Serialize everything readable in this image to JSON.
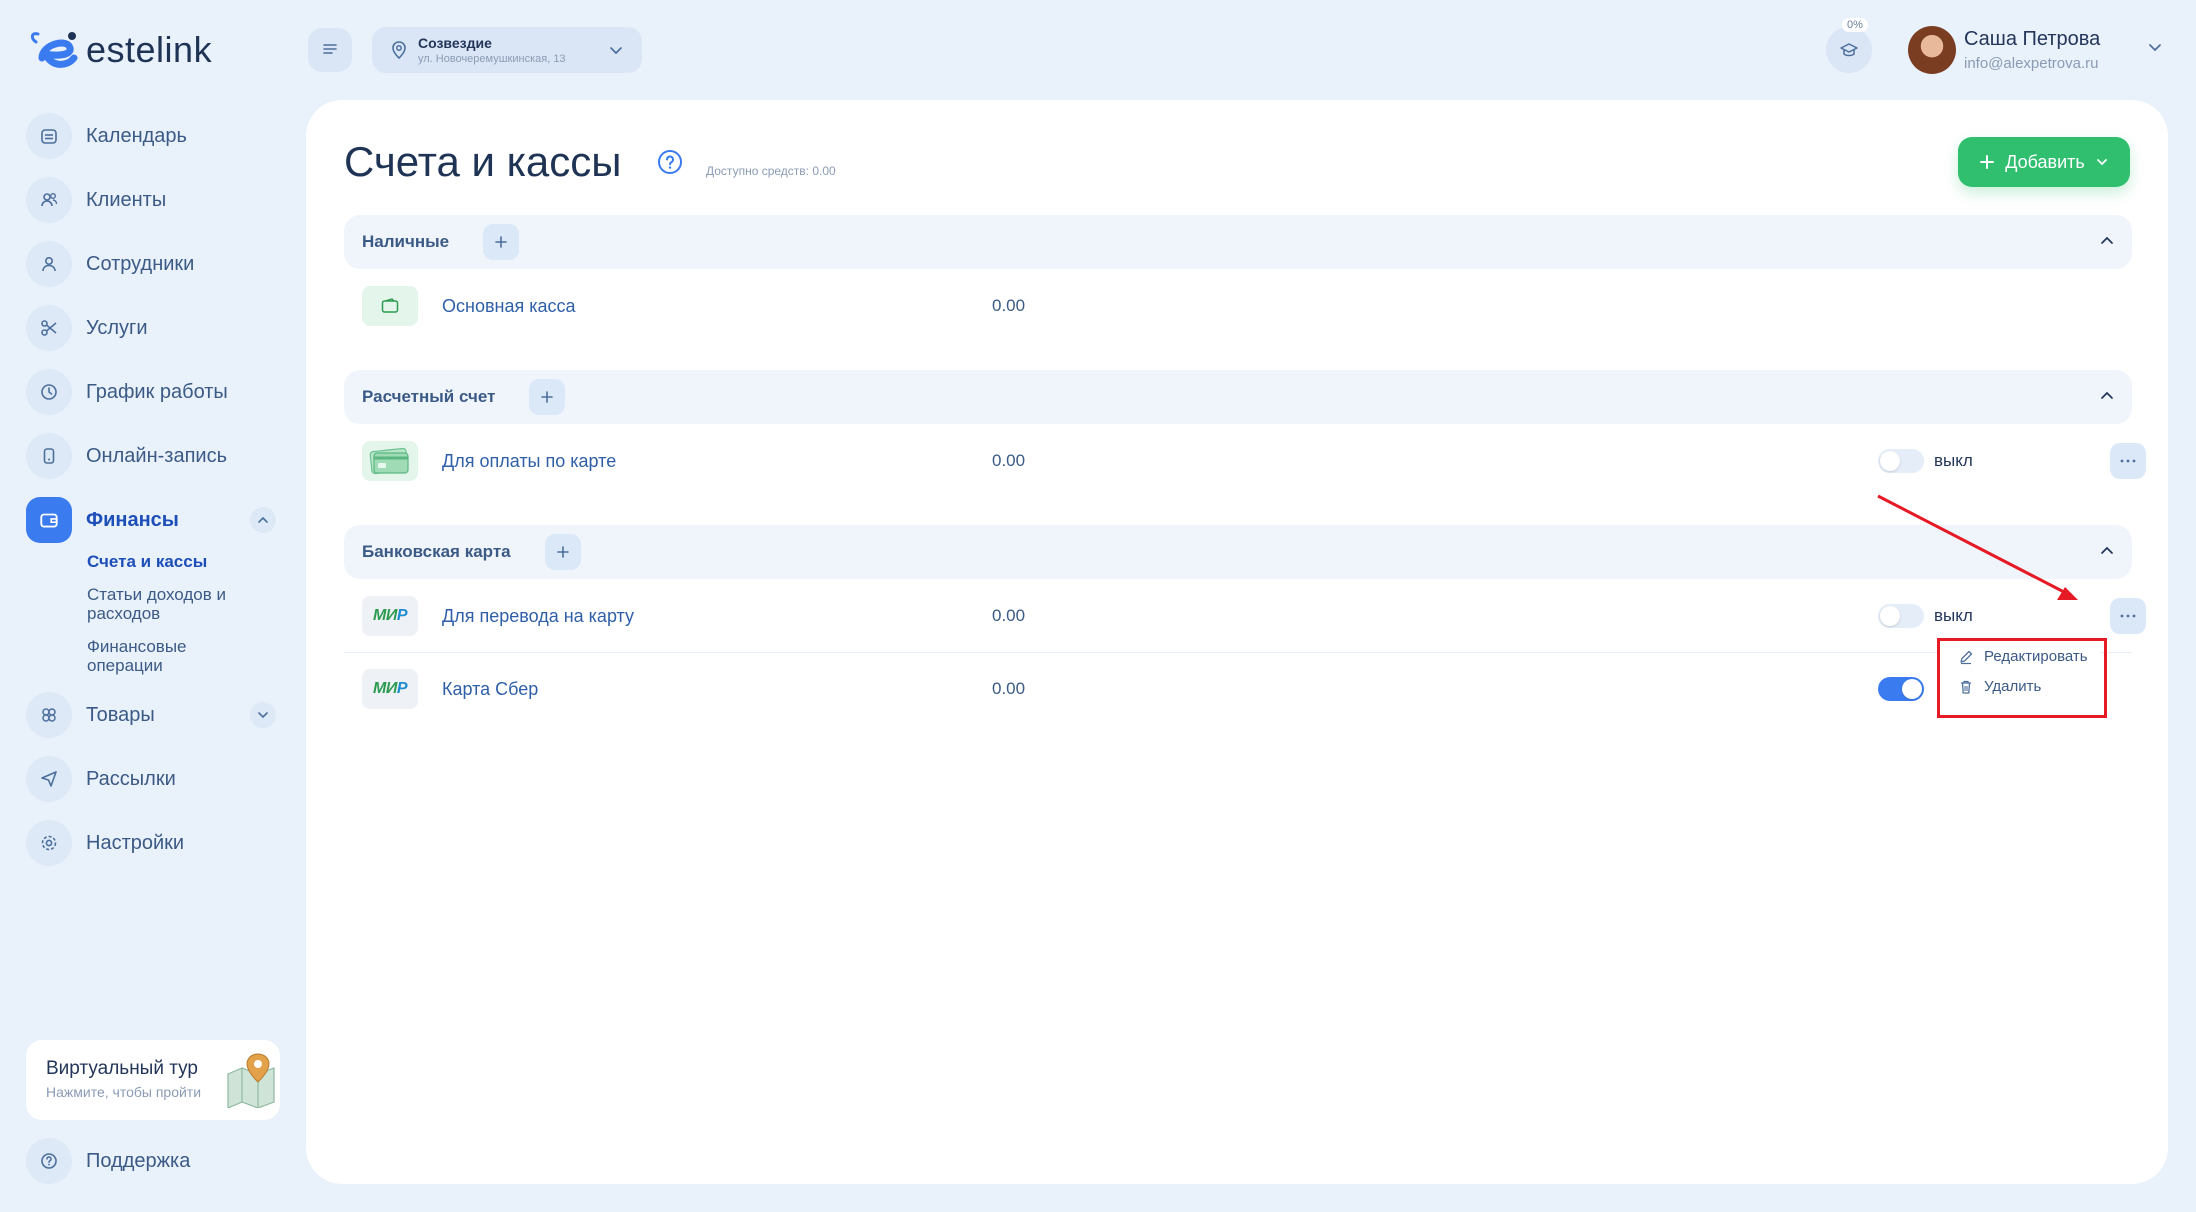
{
  "app": {
    "logo_text": "estelink"
  },
  "sidebar": {
    "items": [
      {
        "id": "calendar",
        "label": "Календарь",
        "icon": "calendar-icon"
      },
      {
        "id": "clients",
        "label": "Клиенты",
        "icon": "users-icon"
      },
      {
        "id": "staff",
        "label": "Сотрудники",
        "icon": "user-icon"
      },
      {
        "id": "services",
        "label": "Услуги",
        "icon": "scissors-icon"
      },
      {
        "id": "schedule",
        "label": "График работы",
        "icon": "clock-icon"
      },
      {
        "id": "booking",
        "label": "Онлайн-запись",
        "icon": "phone-icon"
      },
      {
        "id": "finance",
        "label": "Финансы",
        "icon": "wallet-icon",
        "active": true
      },
      {
        "id": "goods",
        "label": "Товары",
        "icon": "boxes-icon"
      },
      {
        "id": "mailing",
        "label": "Рассылки",
        "icon": "send-icon"
      },
      {
        "id": "settings",
        "label": "Настройки",
        "icon": "gear-icon"
      }
    ],
    "finance_sub": [
      {
        "label": "Счета и кассы",
        "active": true
      },
      {
        "label": "Статьи доходов и расходов"
      },
      {
        "label": "Финансовые операции"
      }
    ],
    "tour": {
      "title": "Виртуальный тур",
      "subtitle": "Нажмите, чтобы пройти"
    },
    "support": {
      "label": "Поддержка"
    }
  },
  "topbar": {
    "location": {
      "name": "Созвездие",
      "address": "ул. Новочеремушкинская, 13"
    },
    "progress_badge": "0%",
    "user": {
      "name": "Саша Петрова",
      "email": "info@alexpetrova.ru"
    }
  },
  "main": {
    "title": "Счета и кассы",
    "available": "Доступно средств: 0.00",
    "add_button": "Добавить",
    "sections": [
      {
        "title": "Наличные",
        "rows": [
          {
            "name": "Основная касса",
            "amount": "0.00",
            "icon": "wallet-icon"
          }
        ]
      },
      {
        "title": "Расчетный счет",
        "rows": [
          {
            "name": "Для оплаты по карте",
            "amount": "0.00",
            "icon": "card-icon",
            "toggle_on": false,
            "toggle_label": "выкл"
          }
        ]
      },
      {
        "title": "Банковская карта",
        "rows": [
          {
            "name": "Для перевода на карту",
            "amount": "0.00",
            "icon": "mir-logo",
            "toggle_on": false,
            "toggle_label": "выкл"
          },
          {
            "name": "Карта Сбер",
            "amount": "0.00",
            "icon": "mir-logo",
            "toggle_on": true
          }
        ]
      }
    ],
    "mir_logo_text": {
      "a": "МИ",
      "b": "Р"
    },
    "dropdown": {
      "edit": "Редактировать",
      "delete": "Удалить"
    }
  },
  "colors": {
    "accent": "#3a7bf0",
    "add_button": "#2fbf6f",
    "annotation": "#e51a24",
    "background": "#e9f1fb"
  }
}
